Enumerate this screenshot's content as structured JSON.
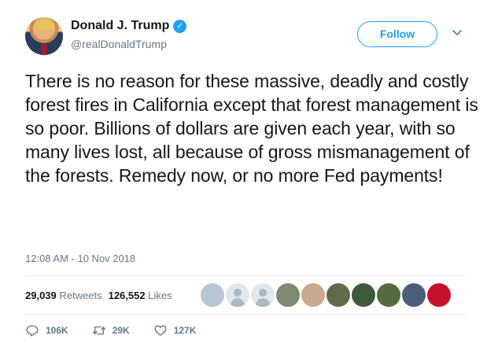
{
  "author": {
    "display_name": "Donald J. Trump",
    "handle": "@realDonaldTrump",
    "verified": true
  },
  "follow_label": "Follow",
  "tweet": {
    "text": "There is no reason for these massive, deadly and costly forest fires in California except that forest management is so poor. Billions of dollars are given each year, with so many lives lost, all because of gross mismanagement of the forests. Remedy now, or no more Fed payments!",
    "timestamp": "12:08 AM - 10 Nov 2018"
  },
  "stats": {
    "retweets_count": "29,039",
    "retweets_label": "Retweets",
    "likes_count": "126,552",
    "likes_label": "Likes"
  },
  "likers": [
    {
      "color": "#b9c6d6"
    },
    {
      "color": "default"
    },
    {
      "color": "default"
    },
    {
      "color": "#7d8a6f"
    },
    {
      "color": "#c9a98f"
    },
    {
      "color": "#5f6b4a"
    },
    {
      "color": "#3e5a3c"
    },
    {
      "color": "#556b3f"
    },
    {
      "color": "#4b5f7a"
    },
    {
      "color": "#c8102e"
    }
  ],
  "actions": {
    "replies": "106K",
    "retweets": "29K",
    "likes": "127K"
  },
  "colors": {
    "accent": "#1da1f2",
    "muted": "#657786",
    "text": "#14171a",
    "divider": "#e6ecf0"
  },
  "icons": [
    "verified-badge-icon",
    "chevron-down-icon",
    "reply-icon",
    "retweet-icon",
    "like-icon"
  ]
}
